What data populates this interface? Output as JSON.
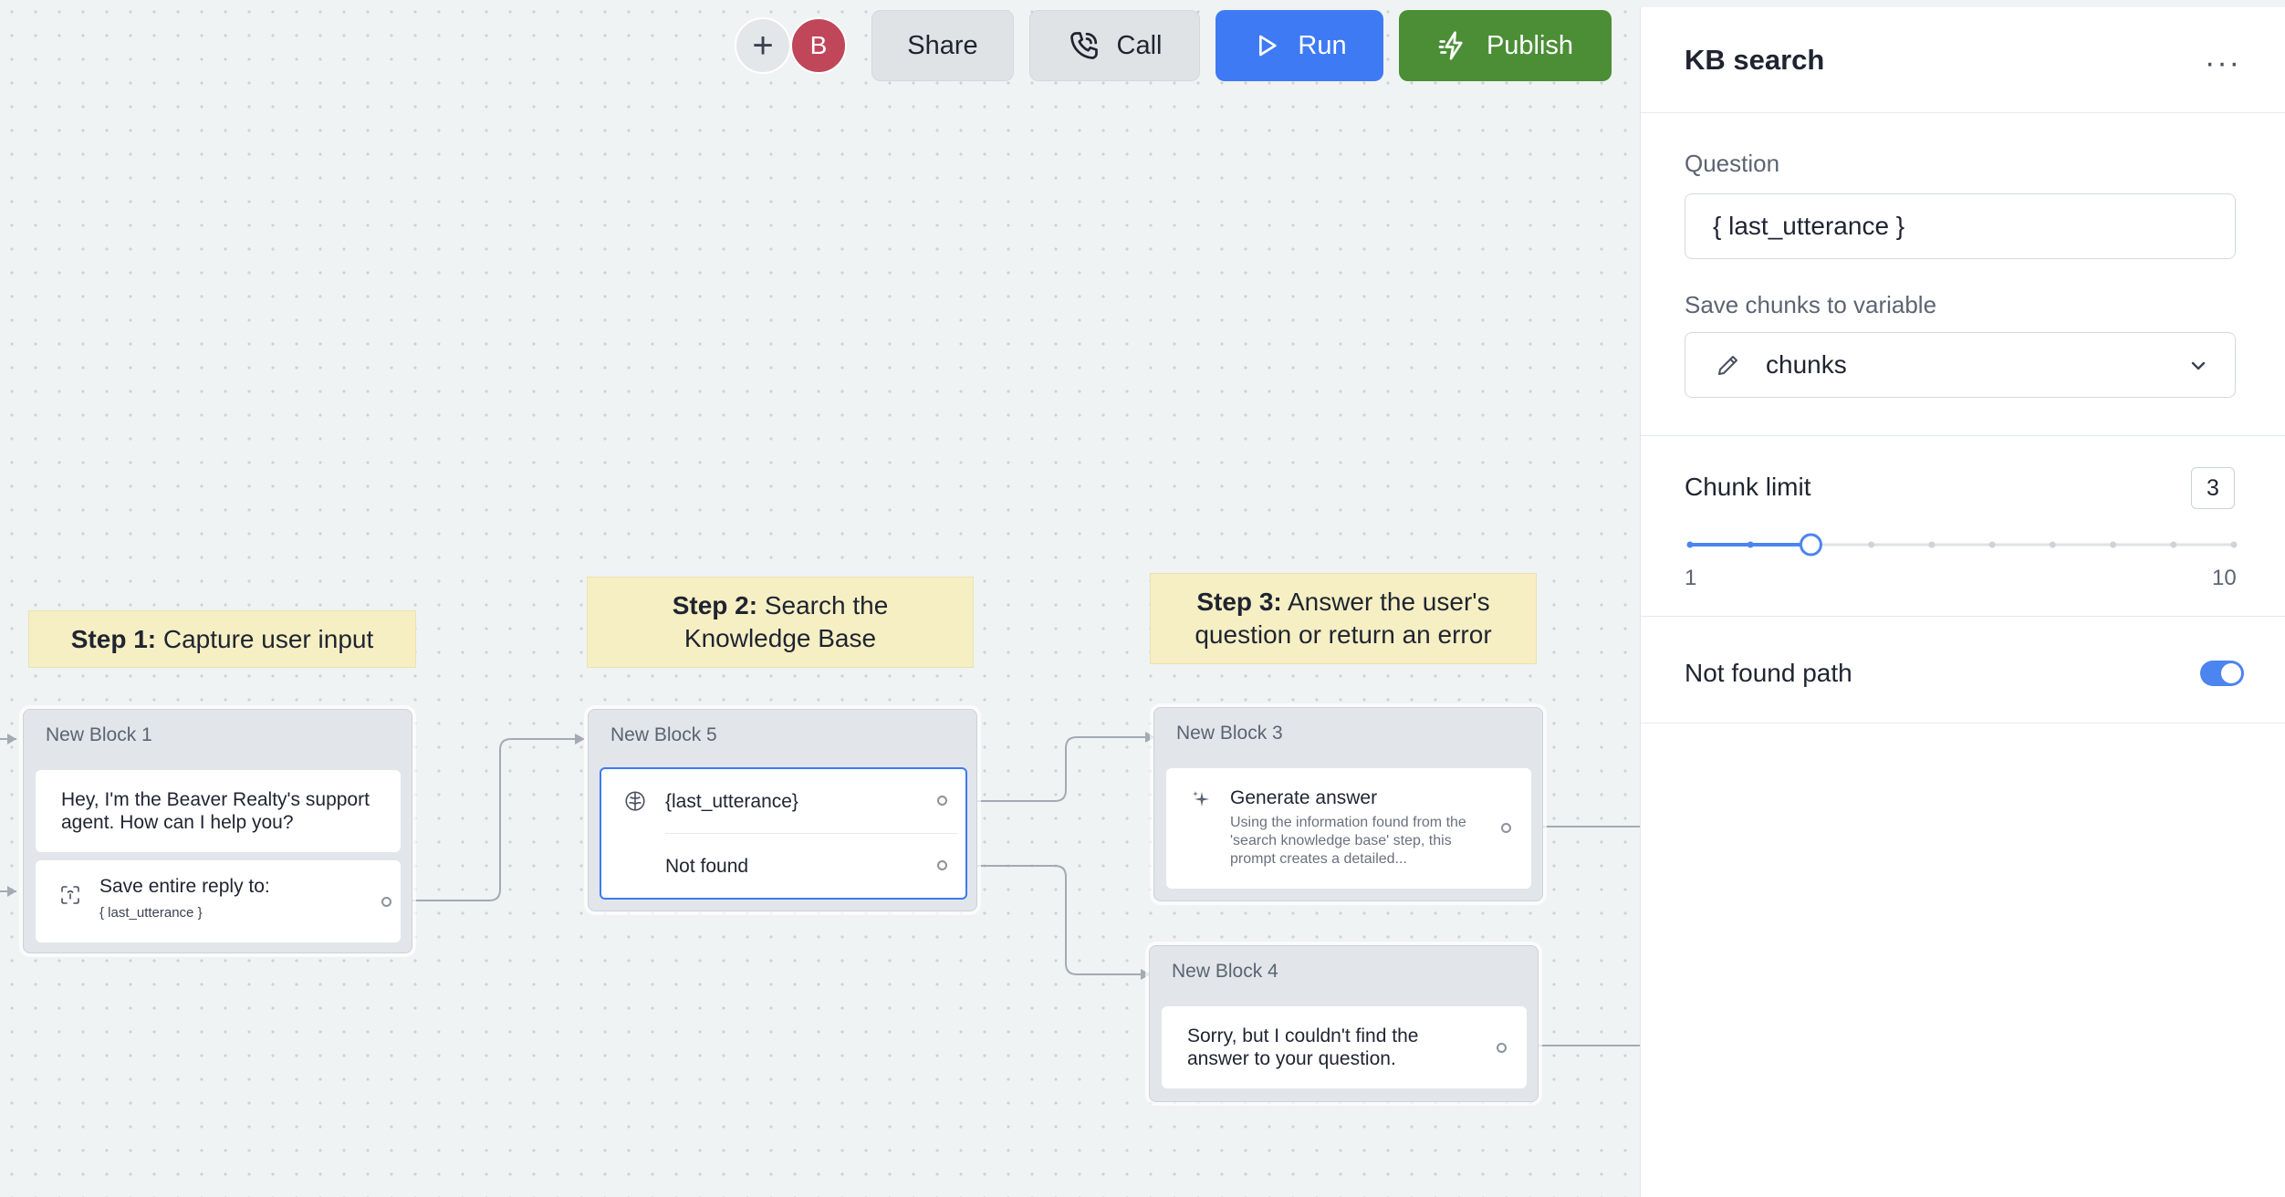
{
  "toolbar": {
    "add_symbol": "+",
    "avatar_initial": "B",
    "share_label": "Share",
    "call_label": "Call",
    "run_label": "Run",
    "publish_label": "Publish"
  },
  "notes": {
    "step1": {
      "bold": "Step 1:",
      "text": " Capture user input"
    },
    "step2": {
      "bold": "Step 2:",
      "text": " Search the Knowledge Base"
    },
    "step3": {
      "bold": "Step 3:",
      "text": " Answer the user's question or return an error"
    }
  },
  "blocks": {
    "block1": {
      "title": "New Block 1",
      "message": "Hey, I'm the Beaver Realty's support agent. How can I help you?",
      "capture_label": "Save entire reply to:",
      "capture_variable": "{ last_utterance }"
    },
    "block5": {
      "title": "New Block 5",
      "query": "{last_utterance}",
      "not_found": "Not found"
    },
    "block3": {
      "title": "New Block 3",
      "step_label": "Generate answer",
      "description": "Using the information found from the 'search knowledge base' step, this prompt creates a detailed..."
    },
    "block4": {
      "title": "New Block 4",
      "message": "Sorry, but I couldn't find the answer to your question."
    }
  },
  "panel": {
    "title": "KB search",
    "more": "···",
    "question_label": "Question",
    "question_value": "{ last_utterance }",
    "save_label": "Save chunks to variable",
    "save_value": "chunks",
    "chunk_limit_label": "Chunk limit",
    "chunk_limit_value": "3",
    "slider_min": "1",
    "slider_max": "10",
    "slider_level": 3,
    "not_found_label": "Not found path",
    "not_found_enabled": true
  },
  "colors": {
    "run": "#3e7af3",
    "publish": "#4b8e36",
    "avatar": "#c0475a",
    "note": "#f6efc4",
    "accent": "#4c84f0"
  }
}
